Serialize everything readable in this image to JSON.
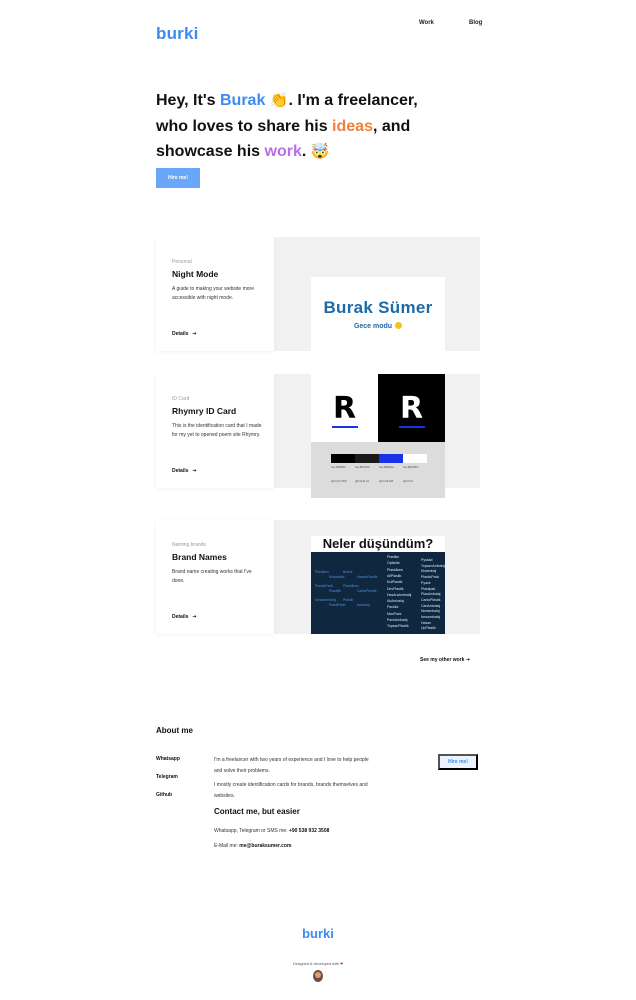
{
  "header": {
    "logo": "burki",
    "nav": [
      {
        "label": "Work"
      },
      {
        "label": "Blog"
      }
    ]
  },
  "hero": {
    "line1_prefix": "Hey, It's ",
    "name": "Burak",
    "line1_suffix": ". I'm a freelancer,",
    "line2_prefix": "who loves to share his ",
    "ideas": "ideas",
    "line2_suffix": ", and",
    "line3_prefix": "showcase his ",
    "work": "work",
    "line3_suffix": ".",
    "emoji_wave": "👏",
    "emoji_face": "🤯",
    "hire_button": "Hire me!"
  },
  "colors": {
    "accent": "#3d8bf2",
    "orange": "#f0803c",
    "purple": "#b96ee8"
  },
  "cards": [
    {
      "tag": "Personal",
      "title": "Night Mode",
      "desc": "A guide to making your website more accessible with night mode.",
      "link": "Details",
      "image": {
        "name": "Burak Sümer",
        "sub": "Gece modu"
      }
    },
    {
      "tag": "ID Card",
      "title": "Rhymry ID Card",
      "desc": "This is the identification card that I made for my yet to opened poem site Rhymry.",
      "link": "Details",
      "image": {
        "letter": "R",
        "swatches": [
          {
            "color": "#000000",
            "label": "hex #000000",
            "label2": "rgb 0,0,0 CMY"
          },
          {
            "color": "#1a1a1a",
            "label": "hex #1F1F1F",
            "label2": "rgb 31,31,31"
          },
          {
            "color": "#1a32e6",
            "label": "hex #0022da",
            "label2": "rgb 0,34,218"
          },
          {
            "color": "#ffffff",
            "label": "hex #FFFFFF",
            "label2": "rgb 0,0,0"
          }
        ]
      }
    },
    {
      "tag": "Naming brands",
      "title": "Brand Names",
      "desc": "Brand name creating works that I've done.",
      "link": "Details",
      "image": {
        "heading": "Neler düşündüm?",
        "words_right": [
          "Plastiks",
          "Optiside",
          "Plasbiliam",
          "AllPlastik",
          "KulPlastik",
          "DevPlastik",
          "HasAraAmbalaj",
          "AkAmbalaj",
          "Packila",
          "MaxPack",
          "PackAmbalaj",
          "TopsanPlastik"
        ],
        "words_far": [
          "Pyskad",
          "TopsanAmbalaj",
          "Mulambaj",
          "PlasticPack",
          "Pyack",
          "Plastipak",
          "PlasAmbalaj",
          "CanloPlastik",
          "CanAmbalaj",
          "Nonambalaj",
          "Innoambalaj",
          "Hasan",
          "UpPlastik"
        ],
        "words_blue": [
          "Plastikon",
          "Nosstable",
          "Brand",
          "HasanPlastik",
          "PlasticPack",
          "Plastifik",
          "Plasbiliam",
          "CanloPlastik",
          "Meskambalaj",
          "PlastiPlast",
          "Plastik",
          "Ambalaj"
        ]
      }
    }
  ],
  "other_work": "See my other work",
  "about": {
    "title": "About me",
    "links": [
      "Whatsapp",
      "Telegram",
      "Github"
    ],
    "p1": "I'm a freelancer with two years of experience and I love to help people and solve their problems.",
    "p2": "I mostly create identification cards for brands, brands themselves and websites.",
    "contact_title": "Contact me, but easier",
    "phone_label": "Whatsapp, Telegram or SMS me: ",
    "phone": "+90 538 932 3508",
    "email_label": "E-Mail me: ",
    "email": "me@buraksumer.com",
    "hire_button": "Hire me!"
  },
  "footer": {
    "logo": "burki",
    "note": "Designed & developed with",
    "heart": "❤"
  }
}
